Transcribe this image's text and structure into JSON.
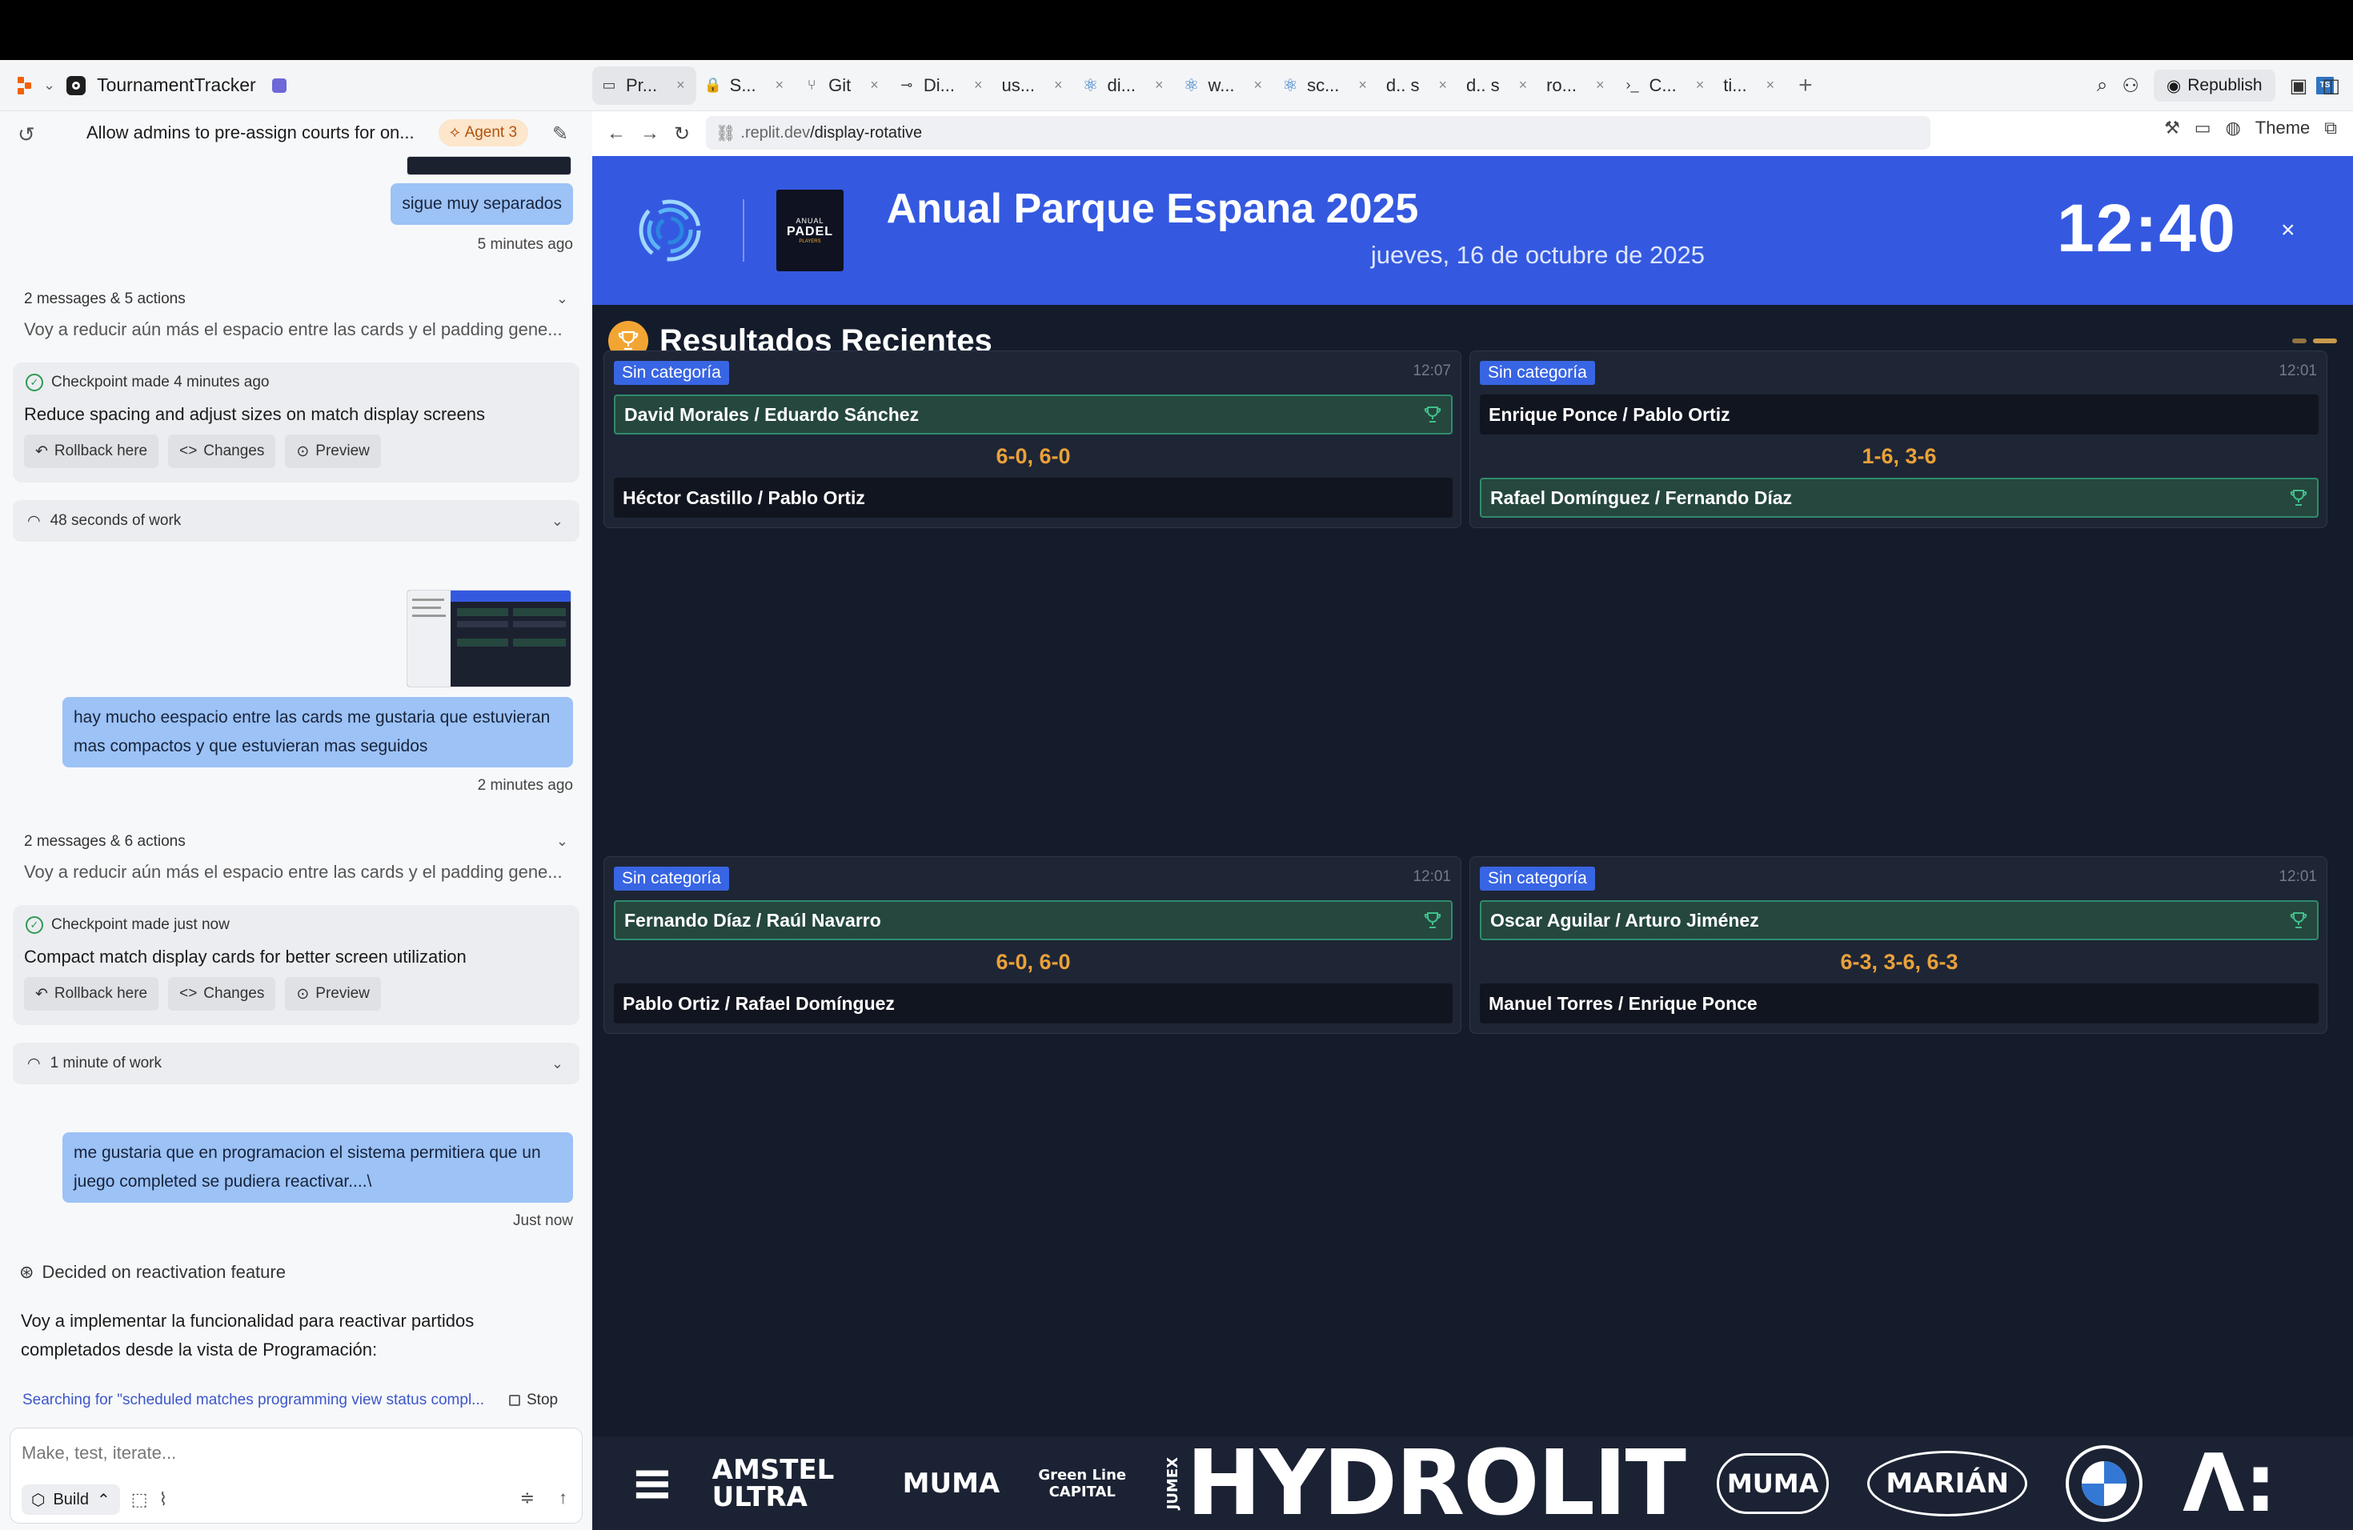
{
  "topbar": {
    "project_name": "TournamentTracker",
    "tabs": [
      {
        "label": "Pr...",
        "icon": "monitor-icon",
        "active": true
      },
      {
        "label": "S...",
        "icon": "lock-icon"
      },
      {
        "label": "Git",
        "icon": "git-branch-icon"
      },
      {
        "label": "Di...",
        "icon": "git-commit-icon"
      },
      {
        "label": "us...",
        "icon": "typescript-icon"
      },
      {
        "label": "di...",
        "icon": "react-icon"
      },
      {
        "label": "w...",
        "icon": "react-icon"
      },
      {
        "label": "sc...",
        "icon": "react-icon"
      },
      {
        "label": "d.. s",
        "icon": "typescript-icon"
      },
      {
        "label": "d.. s",
        "icon": "typescript-icon"
      },
      {
        "label": "ro...",
        "icon": "typescript-icon"
      },
      {
        "label": "C...",
        "icon": "terminal-icon"
      },
      {
        "label": "ti...",
        "icon": "typescript-icon"
      }
    ],
    "republish_label": "Republish"
  },
  "chat": {
    "title": "Allow admins to pre-assign courts for on...",
    "agent_badge": "Agent 3",
    "messages": [
      {
        "text": "sigue muy separados",
        "time": "5 minutes ago"
      },
      {
        "text": "hay mucho eespacio entre las cards me gustaria que estuvieran mas compactos y que estuvieran mas seguidos",
        "time": "2 minutes ago"
      },
      {
        "text": "me gustaria que en programacion el sistema permitiera que un juego completed se pudiera reactivar....\\",
        "time": "Just now"
      }
    ],
    "summaries": [
      {
        "meta": "2 messages & 5 actions",
        "preview": "Voy a reducir aún más el espacio entre las cards y el padding gene..."
      },
      {
        "meta": "2 messages & 6 actions",
        "preview": "Voy a reducir aún más el espacio entre las cards y el padding gene..."
      }
    ],
    "checkpoints": [
      {
        "header": "Checkpoint made 4 minutes ago",
        "title": "Reduce spacing and adjust sizes on match display screens"
      },
      {
        "header": "Checkpoint made just now",
        "title": "Compact match display cards for better screen utilization"
      }
    ],
    "checkpoint_buttons": {
      "rollback": "Rollback here",
      "changes": "Changes",
      "preview": "Preview"
    },
    "work": [
      "48 seconds of work",
      "1 minute of work"
    ],
    "decided": "Decided on reactivation feature",
    "agent_message": "Voy a implementar la funcionalidad para reactivar partidos completados desde la vista de Programación:",
    "searching": "Searching for \"scheduled matches programming view status compl...",
    "stop_label": "Stop",
    "composer_placeholder": "Make, test, iterate...",
    "build_label": "Build"
  },
  "browser": {
    "url_prefix": ".replit.dev",
    "url_path": "/display-rotative",
    "theme_label": "Theme"
  },
  "display": {
    "title": "Anual Parque Espana 2025",
    "date": "jueves, 16 de octubre de 2025",
    "clock": "12:40",
    "close_glyph": "×",
    "logo_lines": [
      "ANUAL",
      "PADEL",
      "PLAYERS"
    ],
    "section_title": "Resultados Recientes",
    "matches": [
      {
        "category": "Sin categoría",
        "time": "12:07",
        "team1": "David Morales / Eduardo Sánchez",
        "team2": "Héctor Castillo / Pablo Ortiz",
        "score": "6-0, 6-0",
        "winner": 1
      },
      {
        "category": "Sin categoría",
        "time": "12:01",
        "team1": "Enrique Ponce / Pablo Ortiz",
        "team2": "Rafael Domínguez / Fernando Díaz",
        "score": "1-6, 3-6",
        "winner": 2
      },
      {
        "category": "Sin categoría",
        "time": "12:01",
        "team1": "Fernando Díaz / Raúl Navarro",
        "team2": "Pablo Ortiz / Rafael Domínguez",
        "score": "6-0, 6-0",
        "winner": 1
      },
      {
        "category": "Sin categoría",
        "time": "12:01",
        "team1": "Oscar Aguilar / Arturo Jiménez",
        "team2": "Manuel Torres / Enrique Ponce",
        "score": "6-3, 3-6, 6-3",
        "winner": 1
      }
    ],
    "sponsors": [
      "AMSTEL ULTRA",
      "MUMA",
      "Green Line CAPITAL",
      "JUMEX",
      "HYDROLIT",
      "MUMA",
      "MARIÁN",
      "BMW"
    ],
    "colors": {
      "header_blue": "#3459e0",
      "bg": "#141c2c",
      "score_orange": "#eaa13a",
      "winner_green": "#2f8c6c"
    }
  }
}
